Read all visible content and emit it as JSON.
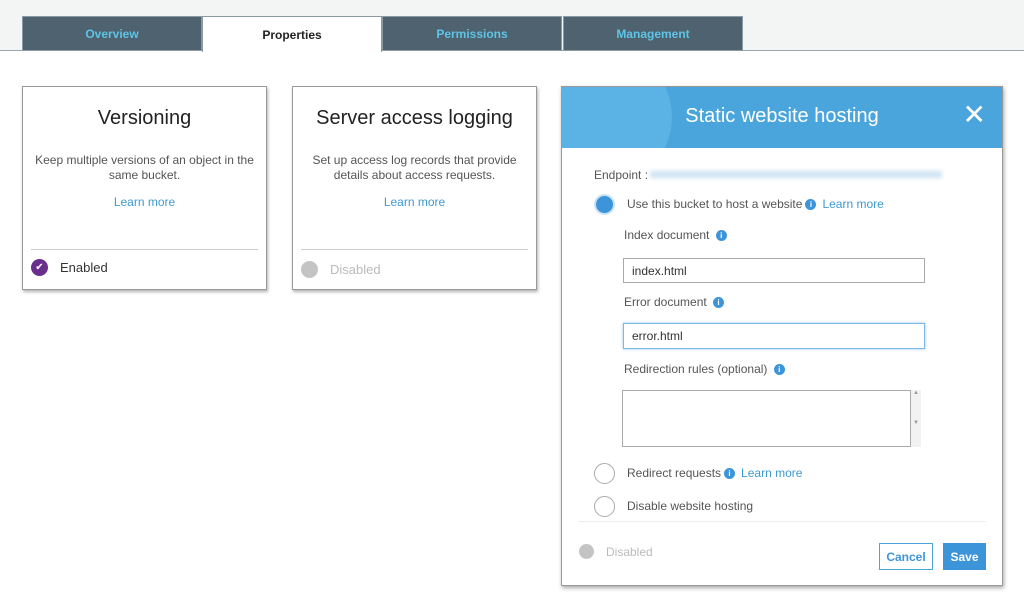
{
  "tabs": [
    {
      "label": "Overview"
    },
    {
      "label": "Properties"
    },
    {
      "label": "Permissions"
    },
    {
      "label": "Management"
    }
  ],
  "active_tab": "Properties",
  "cards": [
    {
      "title": "Versioning",
      "description": "Keep multiple versions of an object in the same bucket.",
      "link": "Learn more",
      "status": "Enabled",
      "status_color": "#6a2f8c"
    },
    {
      "title": "Server access logging",
      "description": "Set up access log records that provide details about access requests.",
      "link": "Learn more",
      "status": "Disabled",
      "status_color": "#c4c4c4"
    }
  ],
  "modal": {
    "title": "Static website hosting",
    "endpoint_label": "Endpoint :",
    "options": [
      {
        "label": "Use this bucket to host a website",
        "link": "Learn more",
        "selected": true
      },
      {
        "label": "Redirect requests",
        "link": "Learn more",
        "selected": false
      },
      {
        "label": "Disable website hosting",
        "selected": false
      }
    ],
    "index_document_label": "Index document",
    "index_document_value": "index.html",
    "error_document_label": "Error document",
    "error_document_value": "error.html",
    "redirection_rules_label": "Redirection rules (optional)",
    "redirection_rules_value": "",
    "status": "Disabled",
    "cancel_label": "Cancel",
    "save_label": "Save",
    "accent_color": "#4aa5dc"
  }
}
